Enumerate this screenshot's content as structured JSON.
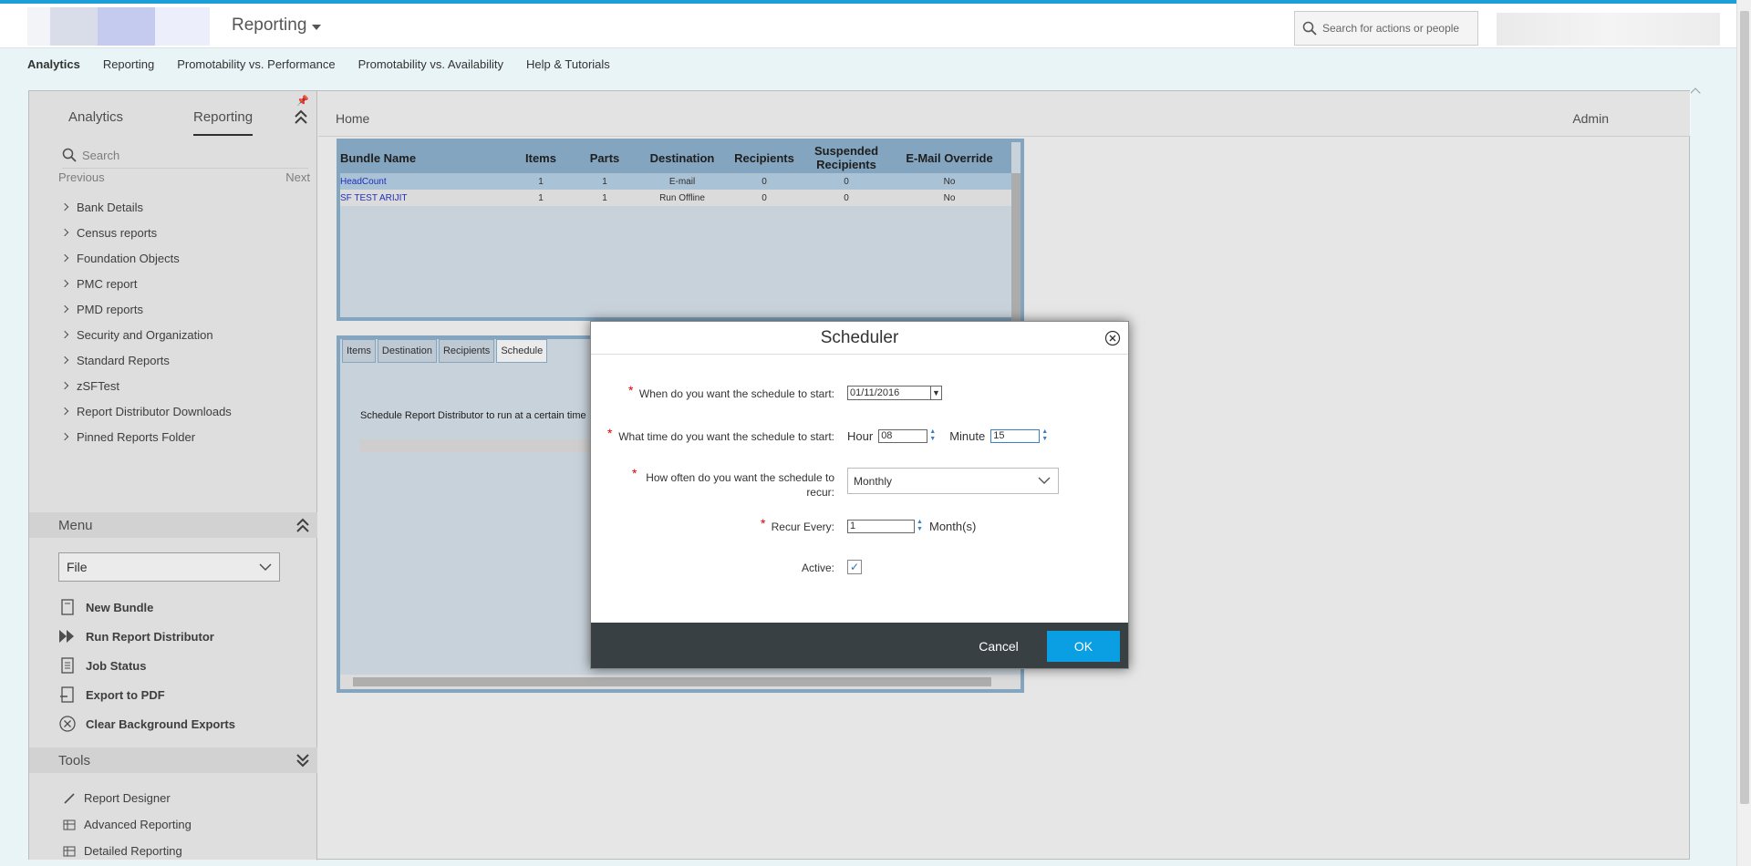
{
  "header": {
    "app_menu_label": "Reporting",
    "search_placeholder": "Search for actions or people"
  },
  "nav": [
    "Analytics",
    "Reporting",
    "Promotability vs. Performance",
    "Promotability vs. Availability",
    "Help & Tutorials"
  ],
  "panel": {
    "tab_analytics": "Analytics",
    "tab_reporting": "Reporting",
    "search_placeholder": "Search",
    "previous": "Previous",
    "next": "Next",
    "folders": [
      "Bank Details",
      "Census reports",
      "Foundation Objects",
      "PMC report",
      "PMD reports",
      "Security and Organization",
      "Standard Reports",
      "zSFTest",
      "Report Distributor Downloads",
      "Pinned Reports Folder"
    ],
    "menu_header": "Menu",
    "menu_select": "File",
    "menu_items": [
      "New Bundle",
      "Run Report Distributor",
      "Job Status",
      "Export to PDF",
      "Clear Background Exports"
    ],
    "tools_header": "Tools",
    "tool_items": [
      "Report Designer",
      "Advanced Reporting",
      "Detailed Reporting"
    ]
  },
  "content": {
    "home": "Home",
    "admin": "Admin"
  },
  "bundle_table": {
    "columns": [
      "Bundle Name",
      "Items",
      "Parts",
      "Destination",
      "Recipients",
      "Suspended Recipients",
      "E-Mail Override"
    ],
    "rows": [
      [
        "HeadCount",
        "1",
        "1",
        "E-mail",
        "0",
        "0",
        "No"
      ],
      [
        "SF TEST ARIJIT",
        "1",
        "1",
        "Run Offline",
        "0",
        "0",
        "No"
      ]
    ]
  },
  "tabs": [
    "Items",
    "Destination",
    "Recipients",
    "Schedule"
  ],
  "schedule_text": "Schedule Report Distributor to run at a certain time",
  "dialog": {
    "title": "Scheduler",
    "start_label": "When do you want the schedule to start:",
    "start_value": "01/11/2016",
    "time_label": "What time do you want the schedule to start:",
    "hour_label": "Hour",
    "hour_value": "08",
    "minute_label": "Minute",
    "minute_value": "15",
    "recur_label_1": "How often do you want the schedule to",
    "recur_label_2": "recur:",
    "recur_value": "Monthly",
    "every_label": "Recur Every:",
    "every_value": "1",
    "every_unit": "Month(s)",
    "active_label": "Active:",
    "active_checked": true,
    "cancel": "Cancel",
    "ok": "OK"
  },
  "colors": {
    "accent": "#0a9ee3",
    "top_stripe": "#1c9fd6",
    "footer": "#394044",
    "table_header": "#8fb4d0"
  }
}
